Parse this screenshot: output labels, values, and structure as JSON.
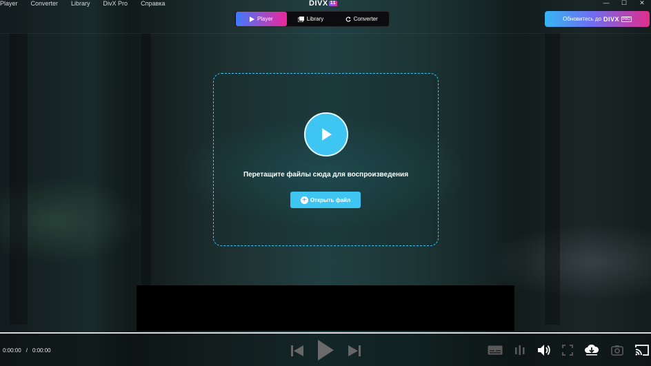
{
  "menu": [
    "Player",
    "Converter",
    "Library",
    "DivX Pro",
    "Справка"
  ],
  "logo": {
    "text": "DIVX",
    "badge": "11"
  },
  "window_controls": {
    "minimize": "—",
    "maximize": "☐",
    "close": "✕"
  },
  "tabs": [
    {
      "label": "Player",
      "active": true,
      "icon": "play-icon"
    },
    {
      "label": "Library",
      "active": false,
      "icon": "library-icon"
    },
    {
      "label": "Converter",
      "active": false,
      "icon": "converter-icon"
    }
  ],
  "upgrade": {
    "label": "Обновитесь до",
    "brand": "DIVX",
    "badge": "PRO"
  },
  "dropzone": {
    "text": "Перетащите файлы сюда для воспроизведения",
    "open_button": "Открыть файл"
  },
  "time": {
    "current": "0:00:00",
    "separator": "/",
    "total": "0:00:00"
  },
  "colors": {
    "accent": "#3ec5f2",
    "gradient_start": "#3e7bff",
    "gradient_end": "#f0259a"
  }
}
